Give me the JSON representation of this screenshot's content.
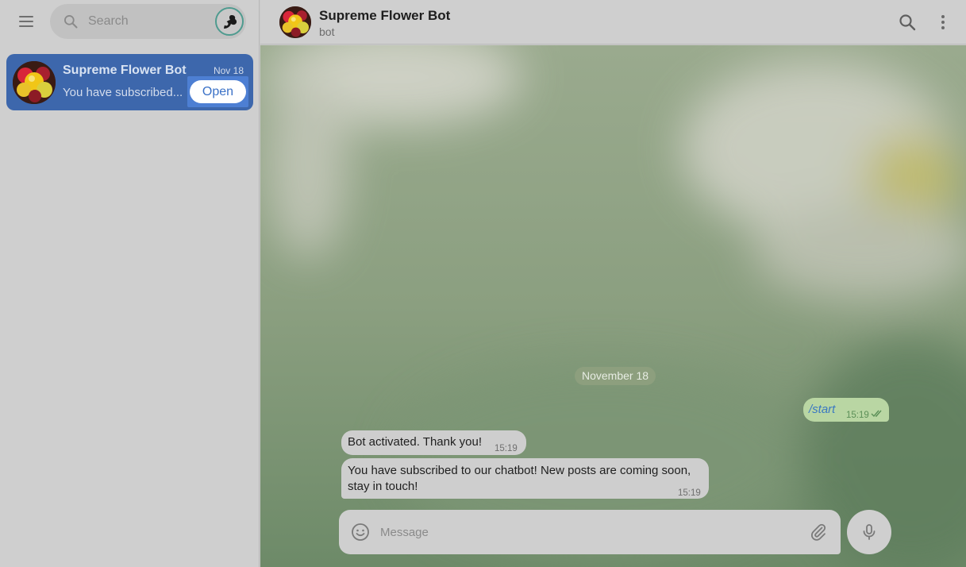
{
  "sidebar": {
    "search": {
      "placeholder": "Search"
    },
    "chats": [
      {
        "name": "Supreme Flower Bot",
        "date": "Nov 18",
        "preview": "You have subscribed...",
        "open_label": "Open"
      }
    ]
  },
  "header": {
    "title": "Supreme Flower Bot",
    "status": "bot"
  },
  "chat": {
    "date_separator": "November 18",
    "messages": [
      {
        "direction": "outgoing",
        "text": "/start",
        "time": "15:19",
        "status_icon": "double-check-icon"
      },
      {
        "direction": "incoming",
        "text": "Bot activated. Thank you!",
        "time": "15:19"
      },
      {
        "direction": "incoming",
        "text": "You have subscribed to our chatbot! New posts are coming soon, stay in touch!",
        "time": "15:19"
      }
    ]
  },
  "composer": {
    "placeholder": "Message"
  },
  "colors": {
    "selected_chat": "#3d67ac",
    "outgoing_bubble": "#b9d6a3",
    "link_text": "#3a78c2",
    "sidebar_bg": "#cfcfcf"
  },
  "icons": [
    "menu-icon",
    "search-icon",
    "avatar-icon",
    "more-vertical-icon",
    "emoji-icon",
    "paperclip-icon",
    "microphone-icon"
  ]
}
